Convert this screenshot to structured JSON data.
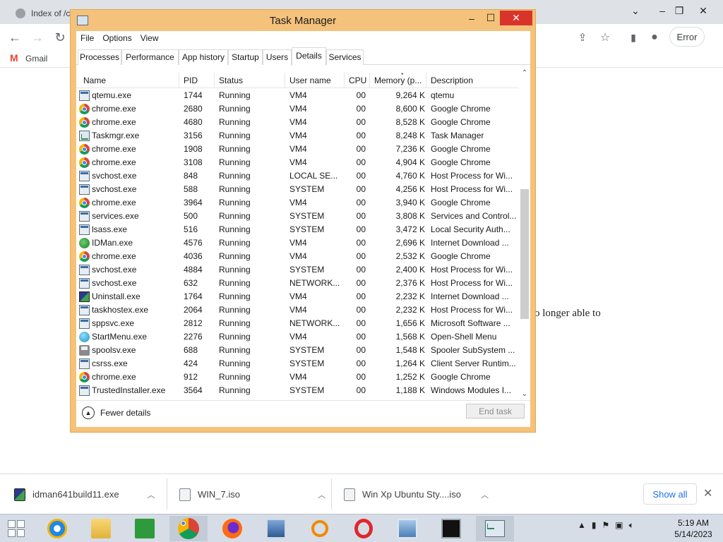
{
  "browser": {
    "tab1_title": "Index of /c...",
    "tabs_extra": [
      "",
      ""
    ],
    "error_label": "Error",
    "bookmarks": [
      {
        "label": "Gmail"
      }
    ],
    "page_text": "o longer able to"
  },
  "window": {
    "title": "Task Manager",
    "minimize_glyph": "–",
    "maximize_glyph": "☐",
    "close_glyph": "✕"
  },
  "menu": [
    "File",
    "Options",
    "View"
  ],
  "tabs": [
    "Processes",
    "Performance",
    "App history",
    "Startup",
    "Users",
    "Details",
    "Services"
  ],
  "active_tab": "Details",
  "columns": [
    "Name",
    "PID",
    "Status",
    "User name",
    "CPU",
    "Memory (p...",
    "Description"
  ],
  "rows": [
    {
      "name": "qtemu.exe",
      "pid": "1744",
      "status": "Running",
      "user": "VM4",
      "cpu": "00",
      "mem": "9,264 K",
      "desc": "qtemu",
      "icon": "window-icon"
    },
    {
      "name": "chrome.exe",
      "pid": "2680",
      "status": "Running",
      "user": "VM4",
      "cpu": "00",
      "mem": "8,600 K",
      "desc": "Google Chrome",
      "icon": "chrome-icon"
    },
    {
      "name": "chrome.exe",
      "pid": "4680",
      "status": "Running",
      "user": "VM4",
      "cpu": "00",
      "mem": "8,528 K",
      "desc": "Google Chrome",
      "icon": "chrome-icon"
    },
    {
      "name": "Taskmgr.exe",
      "pid": "3156",
      "status": "Running",
      "user": "VM4",
      "cpu": "00",
      "mem": "8,248 K",
      "desc": "Task Manager",
      "icon": "task-manager-icon"
    },
    {
      "name": "chrome.exe",
      "pid": "1908",
      "status": "Running",
      "user": "VM4",
      "cpu": "00",
      "mem": "7,236 K",
      "desc": "Google Chrome",
      "icon": "chrome-icon"
    },
    {
      "name": "chrome.exe",
      "pid": "3108",
      "status": "Running",
      "user": "VM4",
      "cpu": "00",
      "mem": "4,904 K",
      "desc": "Google Chrome",
      "icon": "chrome-icon"
    },
    {
      "name": "svchost.exe",
      "pid": "848",
      "status": "Running",
      "user": "LOCAL SE...",
      "cpu": "00",
      "mem": "4,760 K",
      "desc": "Host Process for Wi...",
      "icon": "window-icon"
    },
    {
      "name": "svchost.exe",
      "pid": "588",
      "status": "Running",
      "user": "SYSTEM",
      "cpu": "00",
      "mem": "4,256 K",
      "desc": "Host Process for Wi...",
      "icon": "window-icon"
    },
    {
      "name": "chrome.exe",
      "pid": "3964",
      "status": "Running",
      "user": "VM4",
      "cpu": "00",
      "mem": "3,940 K",
      "desc": "Google Chrome",
      "icon": "chrome-icon"
    },
    {
      "name": "services.exe",
      "pid": "500",
      "status": "Running",
      "user": "SYSTEM",
      "cpu": "00",
      "mem": "3,808 K",
      "desc": "Services and Control...",
      "icon": "window-icon"
    },
    {
      "name": "lsass.exe",
      "pid": "516",
      "status": "Running",
      "user": "SYSTEM",
      "cpu": "00",
      "mem": "3,472 K",
      "desc": "Local Security Auth...",
      "icon": "window-icon"
    },
    {
      "name": "IDMan.exe",
      "pid": "4576",
      "status": "Running",
      "user": "VM4",
      "cpu": "00",
      "mem": "2,696 K",
      "desc": "Internet Download ...",
      "icon": "idm-icon"
    },
    {
      "name": "chrome.exe",
      "pid": "4036",
      "status": "Running",
      "user": "VM4",
      "cpu": "00",
      "mem": "2,532 K",
      "desc": "Google Chrome",
      "icon": "chrome-icon"
    },
    {
      "name": "svchost.exe",
      "pid": "4884",
      "status": "Running",
      "user": "SYSTEM",
      "cpu": "00",
      "mem": "2,400 K",
      "desc": "Host Process for Wi...",
      "icon": "window-icon"
    },
    {
      "name": "svchost.exe",
      "pid": "632",
      "status": "Running",
      "user": "NETWORK...",
      "cpu": "00",
      "mem": "2,376 K",
      "desc": "Host Process for Wi...",
      "icon": "window-icon"
    },
    {
      "name": "Uninstall.exe",
      "pid": "1764",
      "status": "Running",
      "user": "VM4",
      "cpu": "00",
      "mem": "2,232 K",
      "desc": "Internet Download ...",
      "icon": "installer-icon"
    },
    {
      "name": "taskhostex.exe",
      "pid": "2064",
      "status": "Running",
      "user": "VM4",
      "cpu": "00",
      "mem": "2,232 K",
      "desc": "Host Process for Wi...",
      "icon": "window-icon"
    },
    {
      "name": "sppsvc.exe",
      "pid": "2812",
      "status": "Running",
      "user": "NETWORK...",
      "cpu": "00",
      "mem": "1,656 K",
      "desc": "Microsoft Software ...",
      "icon": "window-icon"
    },
    {
      "name": "StartMenu.exe",
      "pid": "2276",
      "status": "Running",
      "user": "VM4",
      "cpu": "00",
      "mem": "1,568 K",
      "desc": "Open-Shell Menu",
      "icon": "start-menu-icon"
    },
    {
      "name": "spoolsv.exe",
      "pid": "688",
      "status": "Running",
      "user": "SYSTEM",
      "cpu": "00",
      "mem": "1,548 K",
      "desc": "Spooler SubSystem ...",
      "icon": "printer-icon"
    },
    {
      "name": "csrss.exe",
      "pid": "424",
      "status": "Running",
      "user": "SYSTEM",
      "cpu": "00",
      "mem": "1,264 K",
      "desc": "Client Server Runtim...",
      "icon": "window-icon"
    },
    {
      "name": "chrome.exe",
      "pid": "912",
      "status": "Running",
      "user": "VM4",
      "cpu": "00",
      "mem": "1,252 K",
      "desc": "Google Chrome",
      "icon": "chrome-icon"
    },
    {
      "name": "TrustedInstaller.exe",
      "pid": "3564",
      "status": "Running",
      "user": "SYSTEM",
      "cpu": "00",
      "mem": "1,188 K",
      "desc": "Windows Modules I...",
      "icon": "window-icon"
    }
  ],
  "footer": {
    "fewer_details": "Fewer details",
    "end_task": "End task"
  },
  "downloads": [
    {
      "name": "idman641build11.exe",
      "icon": "installer-icon"
    },
    {
      "name": "WIN_7.iso",
      "icon": "file-icon"
    },
    {
      "name": "Win Xp Ubuntu Sty....iso",
      "icon": "file-icon"
    }
  ],
  "downloads_show_all": "Show all",
  "taskbar": {
    "apps": [
      "start-icon",
      "internet-explorer-icon",
      "file-explorer-icon",
      "store-icon",
      "chrome-icon",
      "firefox-icon",
      "virtual-machine-icon",
      "search-icon",
      "opera-icon",
      "remote-desktop-icon",
      "command-prompt-icon",
      "task-manager-icon"
    ],
    "time": "5:19 AM",
    "date": "5/14/2023"
  }
}
